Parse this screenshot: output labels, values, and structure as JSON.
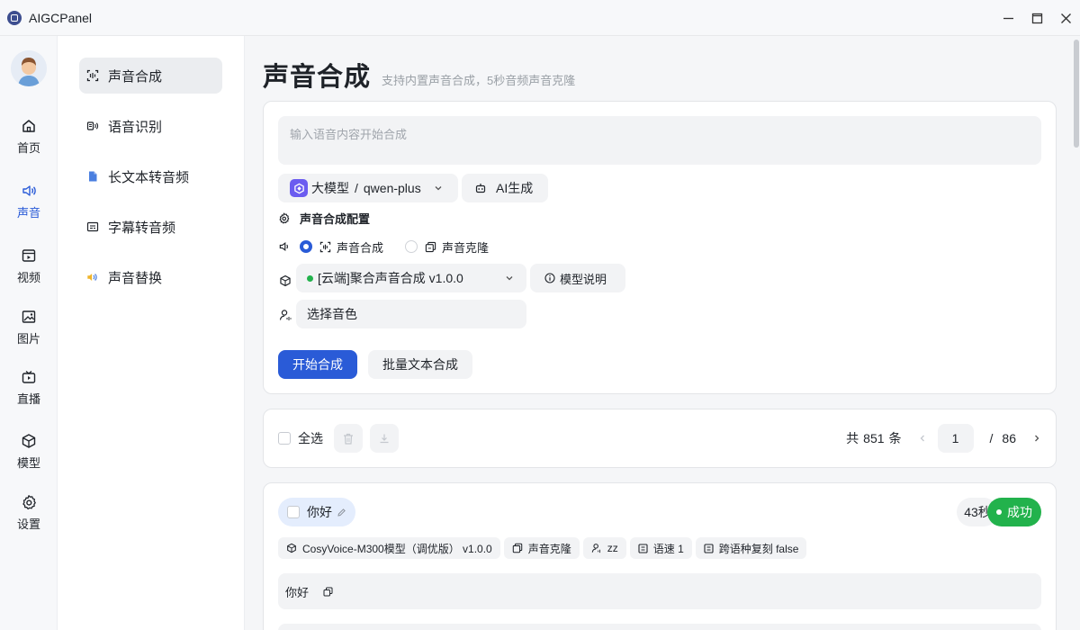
{
  "window": {
    "title": "AIGCPanel"
  },
  "rail": {
    "items": [
      {
        "label": "首页",
        "icon": "home-icon"
      },
      {
        "label": "声音",
        "icon": "sound-icon"
      },
      {
        "label": "视频",
        "icon": "video-icon"
      },
      {
        "label": "图片",
        "icon": "image-icon"
      },
      {
        "label": "直播",
        "icon": "live-icon"
      },
      {
        "label": "模型",
        "icon": "model-icon"
      },
      {
        "label": "设置",
        "icon": "settings-icon"
      }
    ],
    "active": "声音"
  },
  "subnav": {
    "items": [
      {
        "label": "声音合成",
        "icon": "scan-icon"
      },
      {
        "label": "语音识别",
        "icon": "speech-icon"
      },
      {
        "label": "长文本转音频",
        "icon": "document-icon"
      },
      {
        "label": "字幕转音频",
        "icon": "subtitle-icon"
      },
      {
        "label": "声音替换",
        "icon": "replace-icon"
      }
    ],
    "active": "声音合成"
  },
  "page": {
    "title": "声音合成",
    "subtitle": "支持内置声音合成，5秒音频声音克隆"
  },
  "synth": {
    "prompt_placeholder": "输入语音内容开始合成",
    "model_type": "大模型",
    "model_sep": "/",
    "model_name": "qwen-plus",
    "ai_generate": "AI生成",
    "config_title": "声音合成配置",
    "mode_synth": "声音合成",
    "mode_clone": "声音克隆",
    "mode_selected": "声音合成",
    "engine": "[云端]聚合声音合成 v1.0.0",
    "engine_status_color": "#22b24c",
    "model_explain": "模型说明",
    "voice_placeholder": "选择音色",
    "start_button": "开始合成",
    "batch_button": "批量文本合成"
  },
  "list": {
    "select_all": "全选",
    "total_prefix": "共",
    "total": "851",
    "total_suffix": "条",
    "current_page": "1",
    "page_sep": "/",
    "total_pages": "86"
  },
  "record": {
    "title": "你好",
    "duration": "43秒",
    "status": "成功",
    "status_color": "#22b24c",
    "tags": [
      {
        "icon": "model-icon",
        "text": "CosyVoice-M300模型（调优版） v1.0.0"
      },
      {
        "icon": "clone-icon",
        "text": "声音克隆"
      },
      {
        "icon": "user-voice-icon",
        "text": "zz"
      },
      {
        "icon": "param-icon",
        "text": "语速 1"
      },
      {
        "icon": "param-icon",
        "text": "跨语种复刻 false"
      }
    ],
    "text": "你好"
  },
  "colors": {
    "accent": "#2a5bd7",
    "success": "#22b24c"
  }
}
